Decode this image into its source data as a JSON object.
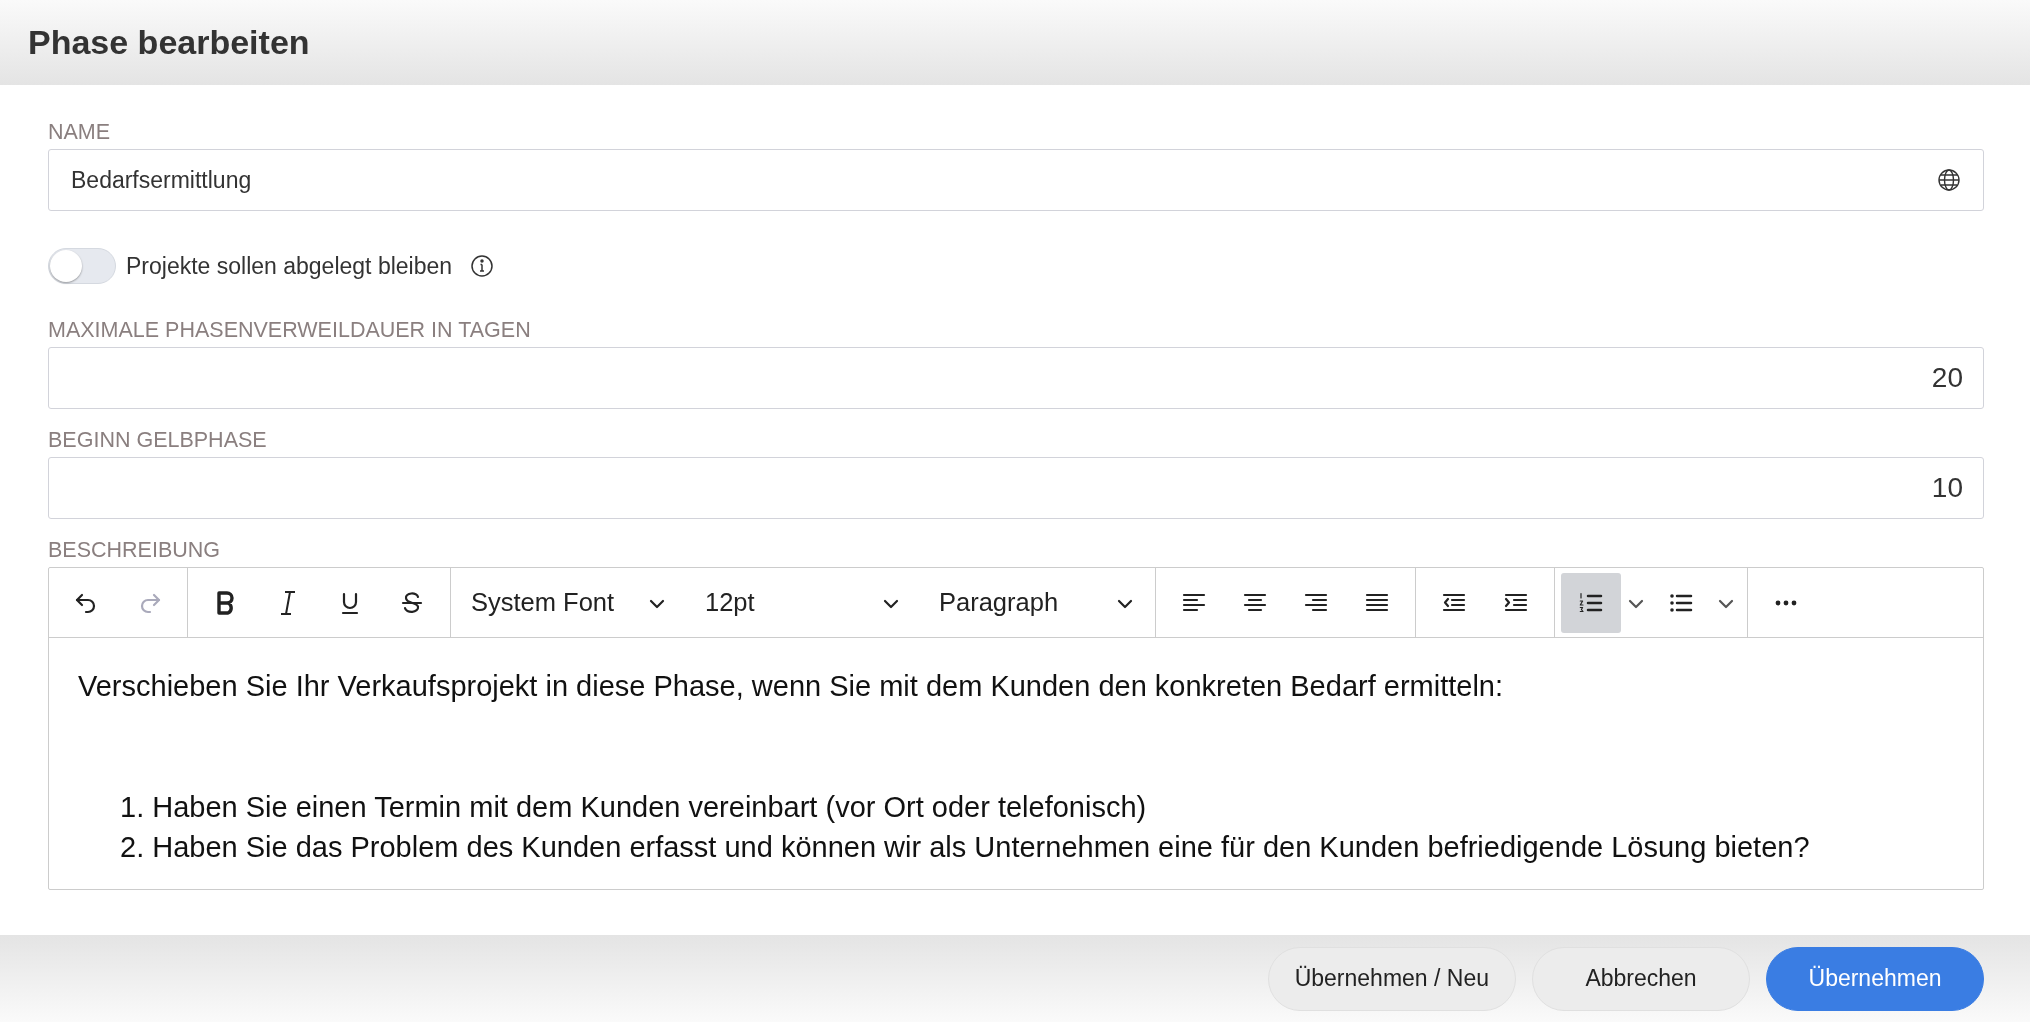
{
  "window": {
    "title": "Phase bearbeiten"
  },
  "name_field": {
    "label": "NAME",
    "value": "Bedarfsermittlung"
  },
  "archive_toggle": {
    "label": "Projekte sollen abgelegt bleiben",
    "on": false
  },
  "max_days_field": {
    "label": "MAXIMALE PHASENVERWEILDAUER IN TAGEN",
    "value": "20"
  },
  "yellow_start_field": {
    "label": "BEGINN GELBPHASE",
    "value": "10"
  },
  "description": {
    "label": "BESCHREIBUNG",
    "toolbar": {
      "undo": {
        "disabled": false
      },
      "redo": {
        "disabled": true
      },
      "font": "System Font",
      "size": "12pt",
      "block": "Paragraph",
      "numbered_list": {
        "selected": true
      },
      "bullet_list": {
        "selected": false
      }
    },
    "paragraph": "Verschieben Sie Ihr Verkaufsprojekt in diese Phase, wenn Sie mit dem Kunden den konkreten Bedarf ermitteln:",
    "list": [
      {
        "number": "1.",
        "text": "Haben Sie einen Termin mit dem Kunden vereinbart (vor Ort oder telefonisch)"
      },
      {
        "number": "2.",
        "text": "Haben Sie das Problem des Kunden erfasst und können wir als Unternehmen eine für den Kunden befriedigende Lösung bieten?"
      }
    ]
  },
  "buttons": [
    {
      "label": "Übernehmen / Neu",
      "kind": "secondary"
    },
    {
      "label": "Abbrechen",
      "kind": "secondary"
    },
    {
      "label": "Übernehmen",
      "kind": "primary"
    }
  ]
}
